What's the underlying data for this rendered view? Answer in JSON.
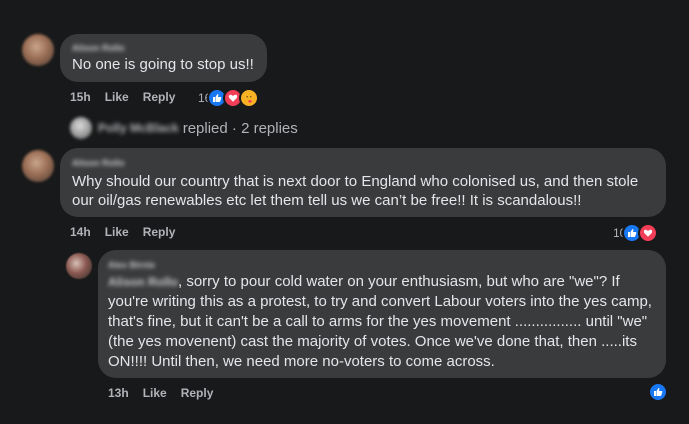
{
  "comments": [
    {
      "author": "Alison Rollo",
      "text": "No one is going to stop us!!",
      "time": "15h",
      "like_label": "Like",
      "reply_label": "Reply",
      "reaction_count": "16",
      "reactions": [
        "like-icon",
        "love-icon",
        "care-icon"
      ]
    },
    {
      "author": "Alison Rollo",
      "text_lines": [
        "Why should our country that is next door to England who colonised us, and then stole",
        "our oil/gas renewables etc let them tell us we can’t be free!! It is scandalous!!"
      ],
      "time": "14h",
      "like_label": "Like",
      "reply_label": "Reply",
      "reaction_count": "10",
      "reactions": [
        "like-icon",
        "love-icon"
      ]
    }
  ],
  "replies_summary": {
    "name": "Polly McBlack",
    "text": "replied · 2 replies"
  },
  "reply": {
    "author": "Alex Birnie",
    "mention": "Alison Rollo",
    "first_line_rest": ", sorry to pour cold water on your enthusiasm, but who are \"we\"? If",
    "lines": [
      "you're writing this as a protest, to try and convert Labour voters into the yes camp,",
      "that's fine, but it can't be a call to arms for the yes movement ................ until \"we\"",
      "(the yes movenent) cast the majority of votes. Once we've done that, then .....its",
      "ON!!!! Until then, we need more no-voters to come across."
    ],
    "time": "13h",
    "like_label": "Like",
    "reply_label": "Reply",
    "reactions": [
      "like-icon"
    ]
  },
  "colors": {
    "background": "#18191a",
    "bubble": "#3a3b3c",
    "like_blue": "#1877f2",
    "love_red": "#f33e58",
    "care_yellow": "#f7b125"
  }
}
